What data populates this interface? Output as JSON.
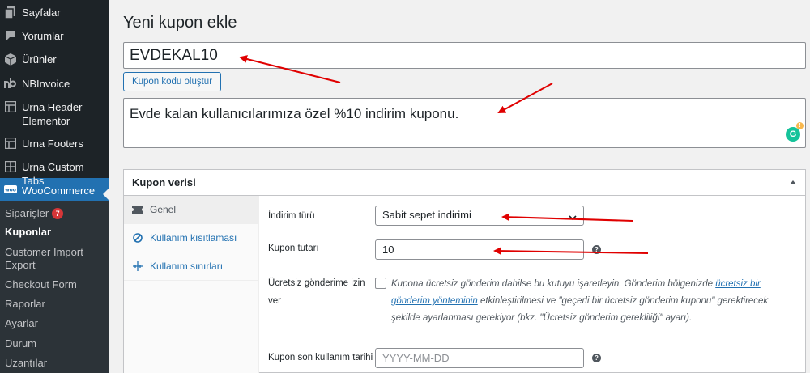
{
  "sidebar": {
    "items": [
      {
        "label": "Sayfalar",
        "icon": "pages-icon"
      },
      {
        "label": "Yorumlar",
        "icon": "comments-icon"
      },
      {
        "label": "Ürünler",
        "icon": "products-icon"
      },
      {
        "label": "NBInvoice",
        "icon": "nb-icon"
      },
      {
        "label": "Urna Header Elementor",
        "icon": "grid-icon"
      },
      {
        "label": "Urna Footers",
        "icon": "grid-icon"
      },
      {
        "label": "Urna Custom Tabs",
        "icon": "grid-icon"
      },
      {
        "label": "WooCommerce",
        "icon": "woo-icon"
      }
    ],
    "submenu": [
      {
        "label": "Siparişler",
        "badge": "7"
      },
      {
        "label": "Kuponlar"
      },
      {
        "label": "Customer Import Export"
      },
      {
        "label": "Checkout Form"
      },
      {
        "label": "Raporlar"
      },
      {
        "label": "Ayarlar"
      },
      {
        "label": "Durum"
      },
      {
        "label": "Uzantılar"
      }
    ],
    "woo_badge": "woo"
  },
  "page": {
    "title": "Yeni kupon ekle",
    "coupon_code": "EVDEKAL10",
    "generate_button": "Kupon kodu oluştur",
    "description": "Evde kalan kullanıcılarımıza özel %10 indirim kuponu.",
    "grammarly_letter": "G",
    "grammarly_alert": "!"
  },
  "coupon_data": {
    "title": "Kupon verisi",
    "tabs": [
      {
        "label": "Genel"
      },
      {
        "label": "Kullanım kısıtlaması"
      },
      {
        "label": "Kullanım sınırları"
      }
    ],
    "discount_type_label": "İndirim türü",
    "discount_type_value": "Sabit sepet indirimi",
    "amount_label": "Kupon tutarı",
    "amount_value": "10",
    "free_shipping_label": "Ücretsiz gönderime izin ver",
    "free_shipping_text_1": "Kupona ücretsiz gönderim dahilse bu kutuyu işaretleyin. Gönderim bölgenizde ",
    "free_shipping_link": "ücretsiz bir gönderim yönteminin",
    "free_shipping_text_2": " etkinleştirilmesi ve \"geçerli bir ücretsiz gönderim kuponu\" gerektirecek şekilde ayarlanması gerekiyor (bkz. \"Ücretsiz gönderim gerekliliği\" ayarı).",
    "expiry_label": "Kupon son kullanım tarihi",
    "expiry_placeholder": "YYYY-MM-DD",
    "help_glyph": "?"
  },
  "colors": {
    "sidebar_bg": "#1d2327",
    "accent": "#2271b1",
    "annotation_arrow": "#e00000"
  }
}
